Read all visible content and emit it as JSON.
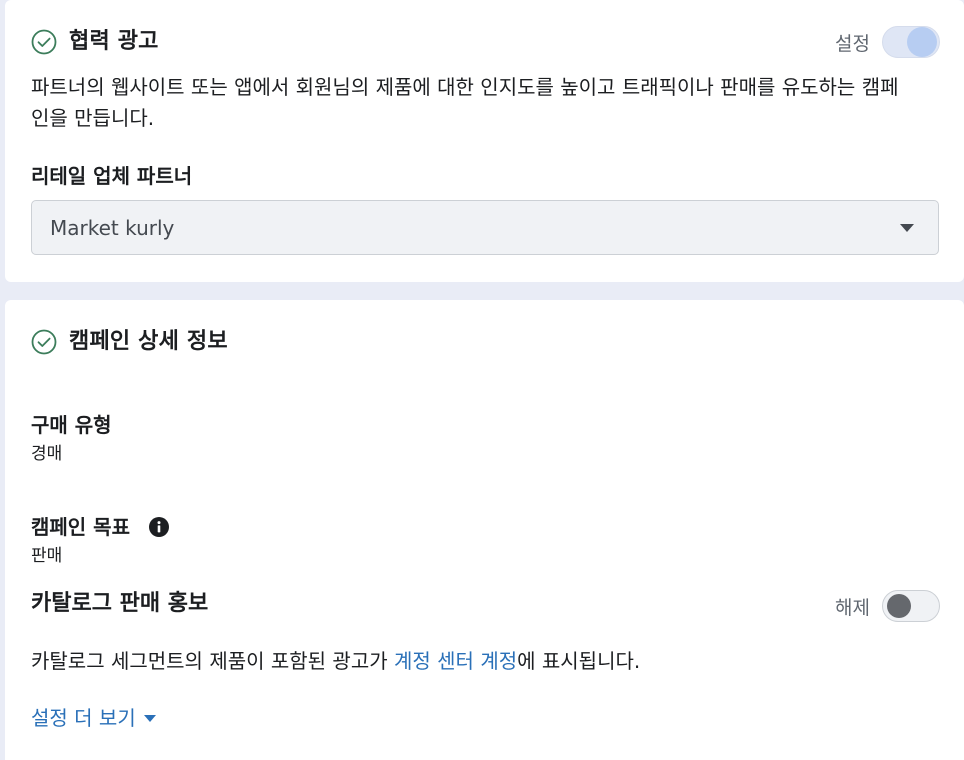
{
  "collab": {
    "title": "협력 광고",
    "toggle_label": "설정",
    "toggle_state": "on",
    "description": "파트너의 웹사이트 또는 앱에서 회원님의 제품에 대한 인지도를 높이고 트래픽이나 판매를 유도하는 캠페인을 만듭니다.",
    "description_line1": "파트너의 웹사이트 또는 앱에서 회원님의 제품에 대한 인지도를 높이고 트래픽이나 판매를 유도하는 캠페",
    "description_line2": "인을 만듭니다.",
    "retail_label": "리테일 업체 파트너",
    "retail_value": "Market kurly"
  },
  "campaign": {
    "title": "캠페인 상세 정보",
    "buy_type_label": "구매 유형",
    "buy_type_value": "경매",
    "objective_label": "캠페인 목표",
    "objective_value": "판매",
    "catalog_label": "카탈로그 판매 홍보",
    "catalog_toggle_label": "해제",
    "catalog_toggle_state": "off",
    "catalog_desc_before": "카탈로그 세그먼트의 제품이 포함된 광고가 ",
    "catalog_desc_link": "계정 센터 계정",
    "catalog_desc_after": "에 표시됩니다.",
    "more_settings": "설정 더 보기"
  },
  "colors": {
    "accent": "#2a70b8",
    "check": "#3c7d5b",
    "background": "#e9ecf6"
  }
}
